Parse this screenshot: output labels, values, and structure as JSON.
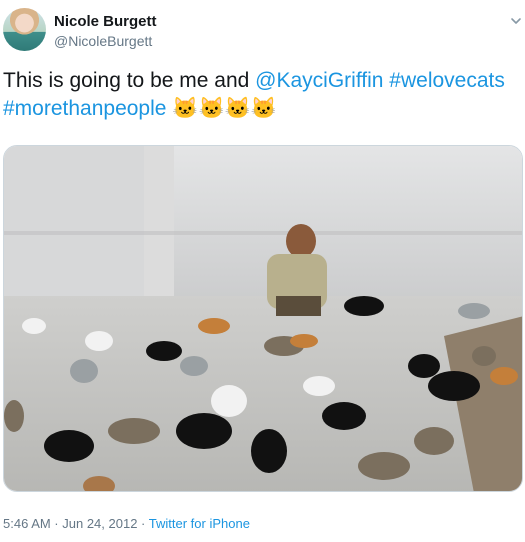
{
  "author": {
    "display_name": "Nicole Burgett",
    "handle": "@NicoleBurgett"
  },
  "tweet": {
    "text_parts": [
      "This is going to be me and ",
      "@KayciGriffin",
      " ",
      "#welovecats",
      "#morethanpeople",
      "🐱🐱🐱🐱"
    ]
  },
  "media": {
    "image_alt_name": "man-with-many-cats-photo"
  },
  "meta": {
    "timestamp": "5:46 AM · Jun 24, 2012",
    "separator": " · ",
    "source": "Twitter for iPhone"
  },
  "colors": {
    "link": "#1b95e0",
    "text": "#14171a",
    "secondary": "#657786"
  }
}
